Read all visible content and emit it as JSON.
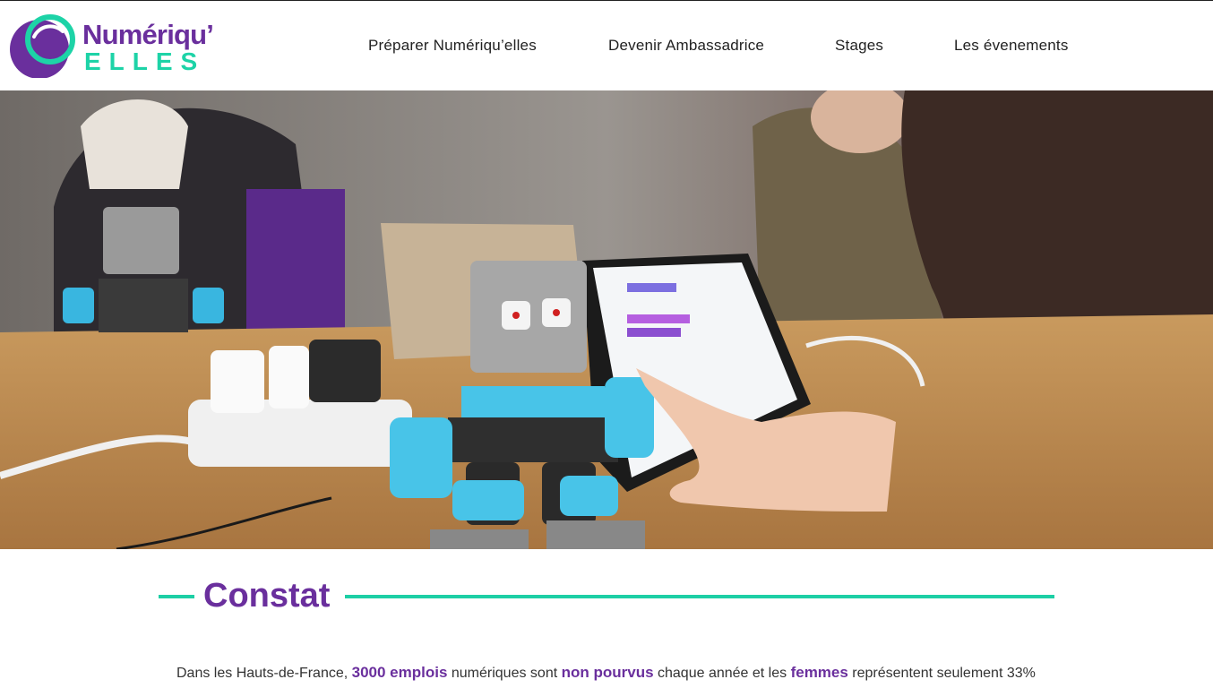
{
  "brand": {
    "name_line1": "Numériqu’",
    "name_line2": "ELLES",
    "colors": {
      "purple": "#6a2f9d",
      "green": "#1dd3a7"
    }
  },
  "nav": {
    "items": [
      {
        "label": "Préparer Numériqu’elles"
      },
      {
        "label": "Devenir Ambassadrice"
      },
      {
        "label": "Stages"
      },
      {
        "label": "Les évenements"
      }
    ]
  },
  "hero": {
    "subject": "Young girls programming a robot with a tablet"
  },
  "section": {
    "title": "Constat",
    "paragraph": {
      "p1": "Dans les Hauts-de-France, ",
      "b1": "3000 emplois",
      "p2": " numériques sont ",
      "b2": "non pourvus",
      "p3": " chaque année et les ",
      "b3": "femmes",
      "p4": " représentent seulement 33%"
    }
  }
}
